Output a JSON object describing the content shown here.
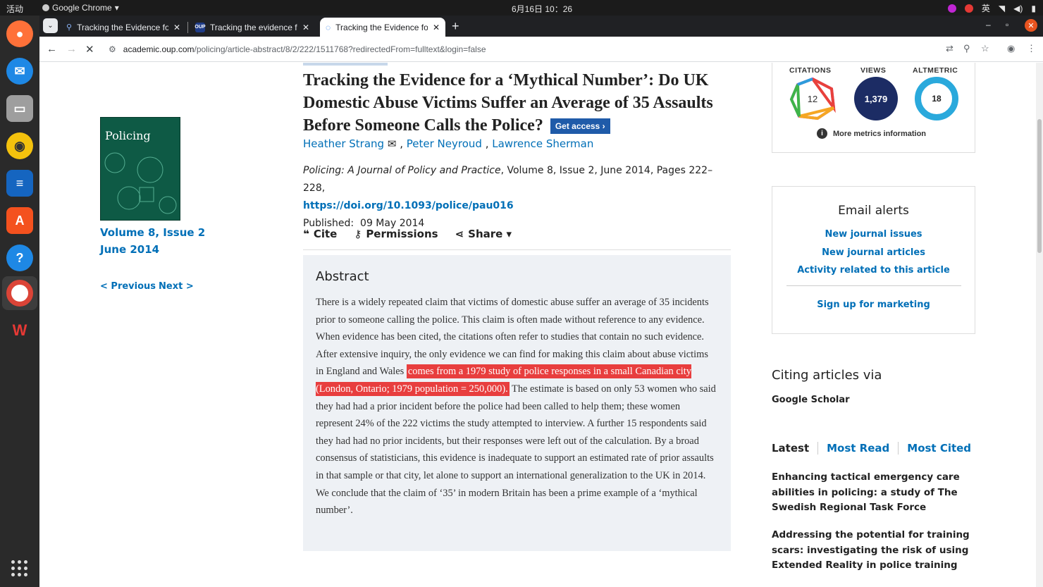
{
  "system": {
    "activities": "活动",
    "app_name": "Google Chrome",
    "clock": "6月16日  10：26",
    "ime": "英"
  },
  "browser": {
    "tabs": [
      {
        "title": "Tracking the Evidence fo",
        "favicon": "search-icon"
      },
      {
        "title": "Tracking the evidence fo",
        "favicon": "OUP"
      },
      {
        "title": "Tracking the Evidence fo",
        "favicon": "loading-icon"
      }
    ],
    "new_tab": "+",
    "url_host": "academic.oup.com",
    "url_path": "/policing/article-abstract/8/2/222/1511768?redirectedFrom=fulltext&login=false"
  },
  "sidebar": {
    "cover_title": "Policing",
    "issue_line1": "Volume 8, Issue 2",
    "issue_line2": "June 2014",
    "previous": "< Previous",
    "next": "Next >"
  },
  "article": {
    "title": "Tracking the Evidence for a ‘Mythical Number’: Do UK Domestic Abuse Victims Suffer an Average of 35 Assaults Before Someone Calls the Police?",
    "get_access": "Get access",
    "authors": [
      "Heather Strang",
      "Peter Neyroud",
      "Lawrence Sherman"
    ],
    "author_sep": ",",
    "journal": "Policing: A Journal of Policy and Practice",
    "journal_rest": ", Volume 8, Issue 2, June 2014, Pages 222–228,",
    "doi": "https://doi.org/10.1093/police/pau016",
    "published_label": "Published:",
    "published_date": "09 May 2014",
    "actions": {
      "cite": "Cite",
      "permissions": "Permissions",
      "share": "Share ▾"
    },
    "abstract_heading": "Abstract",
    "abstract_before": "There is a widely repeated claim that victims of domestic abuse suffer an average of 35 incidents prior to someone calling the police. This claim is often made without reference to any evidence. When evidence has been cited, the citations often refer to studies that contain no such evidence. After extensive inquiry, the only evidence we can find for making this claim about abuse victims in England and Wales ",
    "abstract_highlight": "comes from a 1979 study of police responses in a small Canadian city (London, Ontario; 1979 population = 250,000).",
    "abstract_after": " The estimate is based on only 53 women who said they had had a prior incident before the police had been called to help them; these women represent 24% of the 222 victims the study attempted to interview. A further 15 respondents said they had had no prior incidents, but their responses were left out of the calculation. By a broad consensus of statisticians, this evidence is inadequate to support an estimated rate of prior assaults in that sample or that city, let alone to support an international generalization to the UK in 2014. We conclude that the claim of ‘35’ in modern Britain has been a prime example of a ‘mythical number’."
  },
  "metrics": {
    "citations_label": "CITATIONS",
    "citations": "12",
    "views_label": "VIEWS",
    "views": "1,379",
    "altmetric_label": "ALTMETRIC",
    "altmetric": "18",
    "more": "More metrics information"
  },
  "alerts": {
    "heading": "Email alerts",
    "links": [
      "New journal issues",
      "New journal articles",
      "Activity related to this article"
    ],
    "marketing": "Sign up for marketing"
  },
  "citing": {
    "heading": "Citing articles via",
    "google_scholar": "Google Scholar"
  },
  "latest_tabs": [
    "Latest",
    "Most Read",
    "Most Cited"
  ],
  "latest_items": [
    "Enhancing tactical emergency care abilities in policing: a study of The Swedish Regional Task Force",
    "Addressing the potential for training scars: investigating the risk of using Extended Reality in police training"
  ],
  "colors": {
    "link": "#006fb7",
    "highlight": "#e83e3e",
    "views": "#1c2c64",
    "altmetric": "#2aa9dc",
    "access": "#1f5ba9"
  }
}
